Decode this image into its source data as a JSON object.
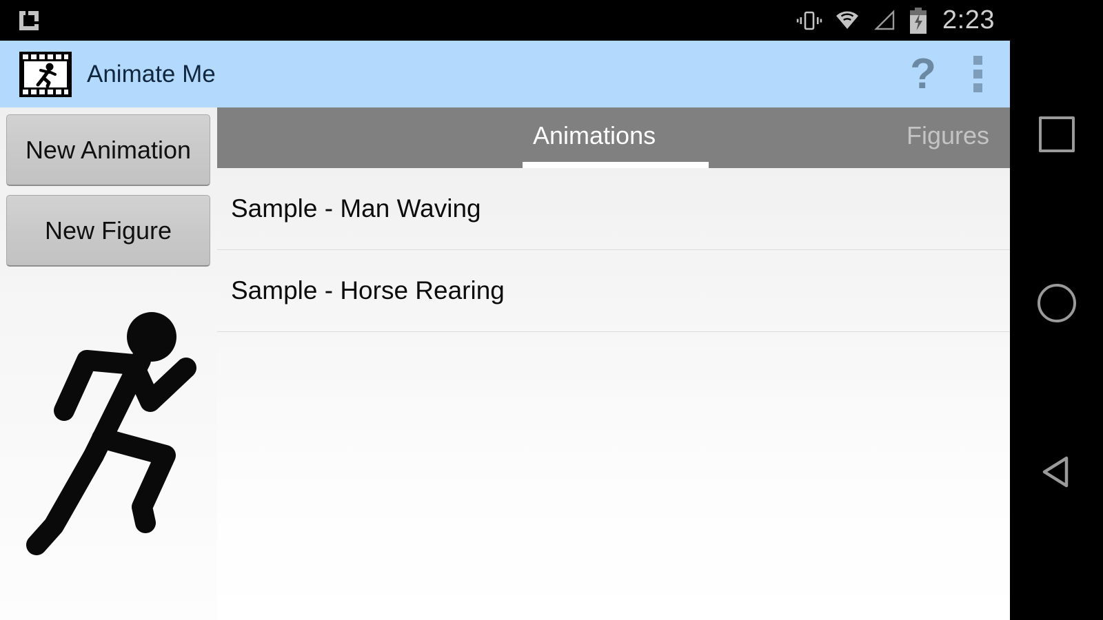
{
  "status_bar": {
    "notification_icon": "app-notification-icon",
    "icons": [
      "vibrate-icon",
      "wifi-icon",
      "signal-no-service-icon",
      "battery-charging-icon"
    ],
    "clock": "2:23"
  },
  "action_bar": {
    "app_icon": "film-strip-running-figure-icon",
    "title": "Animate Me",
    "help_label": "?",
    "help_icon": "help-question-icon",
    "overflow_icon": "overflow-menu-icon",
    "background_color": "#b3d9fd",
    "title_color": "#10273f"
  },
  "sidebar": {
    "buttons": [
      {
        "label": "New Animation",
        "name": "new-animation-button"
      },
      {
        "label": "New Figure",
        "name": "new-figure-button"
      }
    ],
    "illustration": "running-stick-figure-illustration"
  },
  "tabs": {
    "items": [
      {
        "label": "Animations",
        "selected": true
      },
      {
        "label": "Figures",
        "selected": false
      }
    ],
    "bar_color": "#808080",
    "active_color": "#ffffff",
    "inactive_color": "#c4c4c4",
    "indicator_color": "#ffffff"
  },
  "list": {
    "items": [
      {
        "label": "Sample - Man Waving"
      },
      {
        "label": "Sample - Horse Rearing"
      }
    ]
  },
  "nav_bar": {
    "keys": [
      {
        "name": "recents-button",
        "icon": "square-icon"
      },
      {
        "name": "home-button",
        "icon": "circle-icon"
      },
      {
        "name": "back-button",
        "icon": "triangle-back-icon"
      }
    ]
  }
}
